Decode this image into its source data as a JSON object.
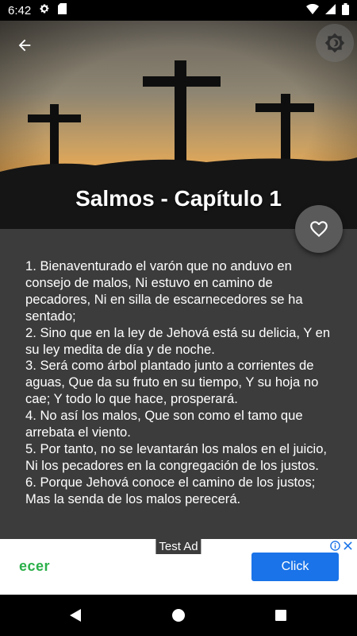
{
  "status_bar": {
    "time": "6:42",
    "icons_left": [
      "settings-icon",
      "sd-card-icon"
    ],
    "icons_right": [
      "wifi-icon",
      "signal-icon",
      "battery-icon"
    ]
  },
  "header": {
    "title": "Salmos - Capítulo 1",
    "back_icon": "arrow-back-icon",
    "theme_icon": "brightness-icon",
    "favorite_icon": "heart-outline-icon"
  },
  "verses": [
    "1. Bienaventurado el varón que no anduvo en consejo de malos, Ni estuvo en camino de pecadores, Ni en silla de escarnecedores se ha sentado;",
    "2. Sino que en la ley de Jehová está su delicia, Y en su ley medita de día y de noche.",
    "3. Será como árbol plantado junto a corrientes de aguas, Que da su fruto en su tiempo, Y su hoja no cae; Y todo lo que hace, prosperará.",
    "4. No así los malos, Que son como el tamo que arrebata el viento.",
    "5. Por tanto, no se levantarán los malos en el juicio, Ni los pecadores en la congregación de los justos.",
    "6. Porque Jehová conoce el camino de los justos; Mas la senda de los malos perecerá."
  ],
  "ad": {
    "label": "Test Ad",
    "brand": "ecer",
    "cta": "Click"
  },
  "colors": {
    "content_bg": "#3c3c3c",
    "fab_bg": "#5a5a5a",
    "ad_cta": "#1a73e8",
    "ad_brand": "#2bb04a"
  }
}
